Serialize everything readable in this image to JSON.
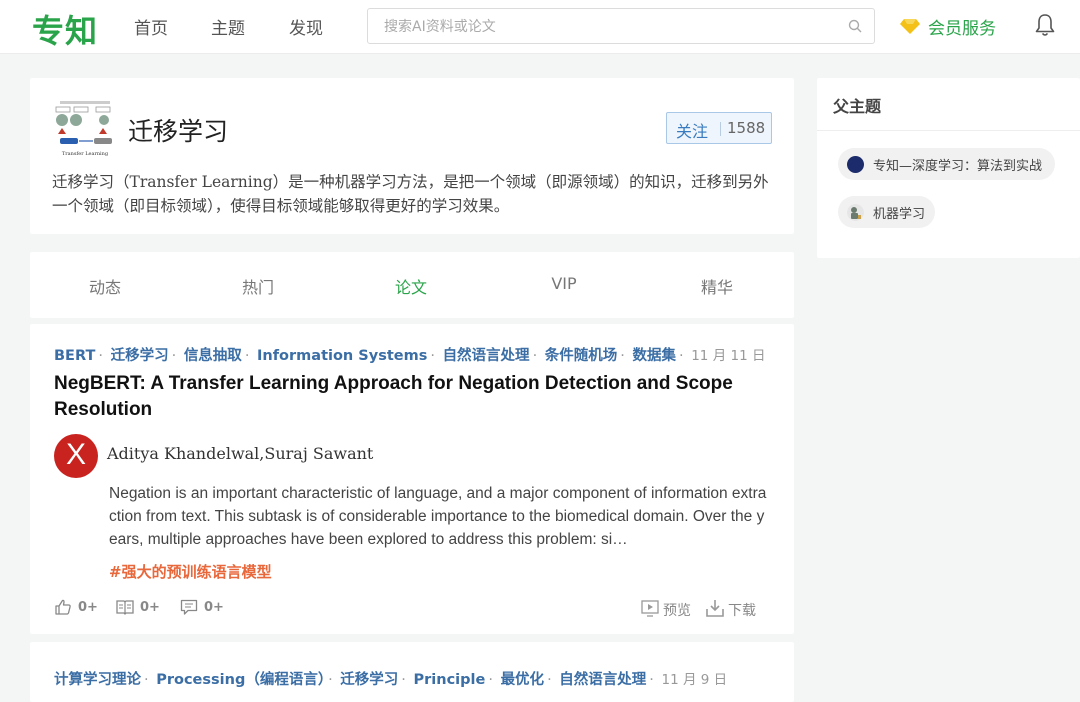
{
  "header": {
    "logo": "专知",
    "nav": [
      "首页",
      "主题",
      "发现"
    ],
    "search_placeholder": "搜索AI资料或论文",
    "vip_label": "会员服务"
  },
  "topic": {
    "title": "迁移学习",
    "follow_label": "关注",
    "follow_count": "1588",
    "description": "迁移学习（Transfer Learning）是一种机器学习方法，是把一个领域（即源领域）的知识，迁移到另外一个领域（即目标领域），使得目标领域能够取得更好的学习效果。",
    "thumbnail_caption": "Transfer Learning"
  },
  "tabs": [
    "动态",
    "热门",
    "论文",
    "VIP",
    "精华"
  ],
  "active_tab": "论文",
  "papers": [
    {
      "tags": [
        "BERT",
        "迁移学习",
        "信息抽取",
        "Information Systems",
        "自然语言处理",
        "条件随机场",
        "数据集"
      ],
      "date": "11 月 11 日",
      "title": "NegBERT: A Transfer Learning Approach for Negation Detection and Scope Resolution",
      "avatar_letter": "X",
      "authors": "Aditya Khandelwal,Suraj Sawant",
      "abstract": "Negation is an important characteristic of language, and a major component of information extraction from text. This subtask is of considerable importance to the biomedical domain. Over the years, multiple approaches have been explored to address this problem: si…",
      "hashtag": "#强大的预训练语言模型",
      "likes": "0+",
      "reads": "0+",
      "comments": "0+",
      "preview_label": "预览",
      "download_label": "下载"
    },
    {
      "tags": [
        "计算学习理论",
        "Processing（编程语言）",
        "迁移学习",
        "Principle",
        "最优化",
        "自然语言处理"
      ],
      "date": "11 月 9 日"
    }
  ],
  "sidebar": {
    "title": "父主题",
    "chips": [
      "专知—深度学习：算法到实战",
      "机器学习"
    ]
  },
  "colors": {
    "brand_green": "#2aa44a",
    "tag_blue": "#3b6ea5",
    "hashtag_orange": "#e8673b",
    "avatar_red": "#c9231f"
  }
}
